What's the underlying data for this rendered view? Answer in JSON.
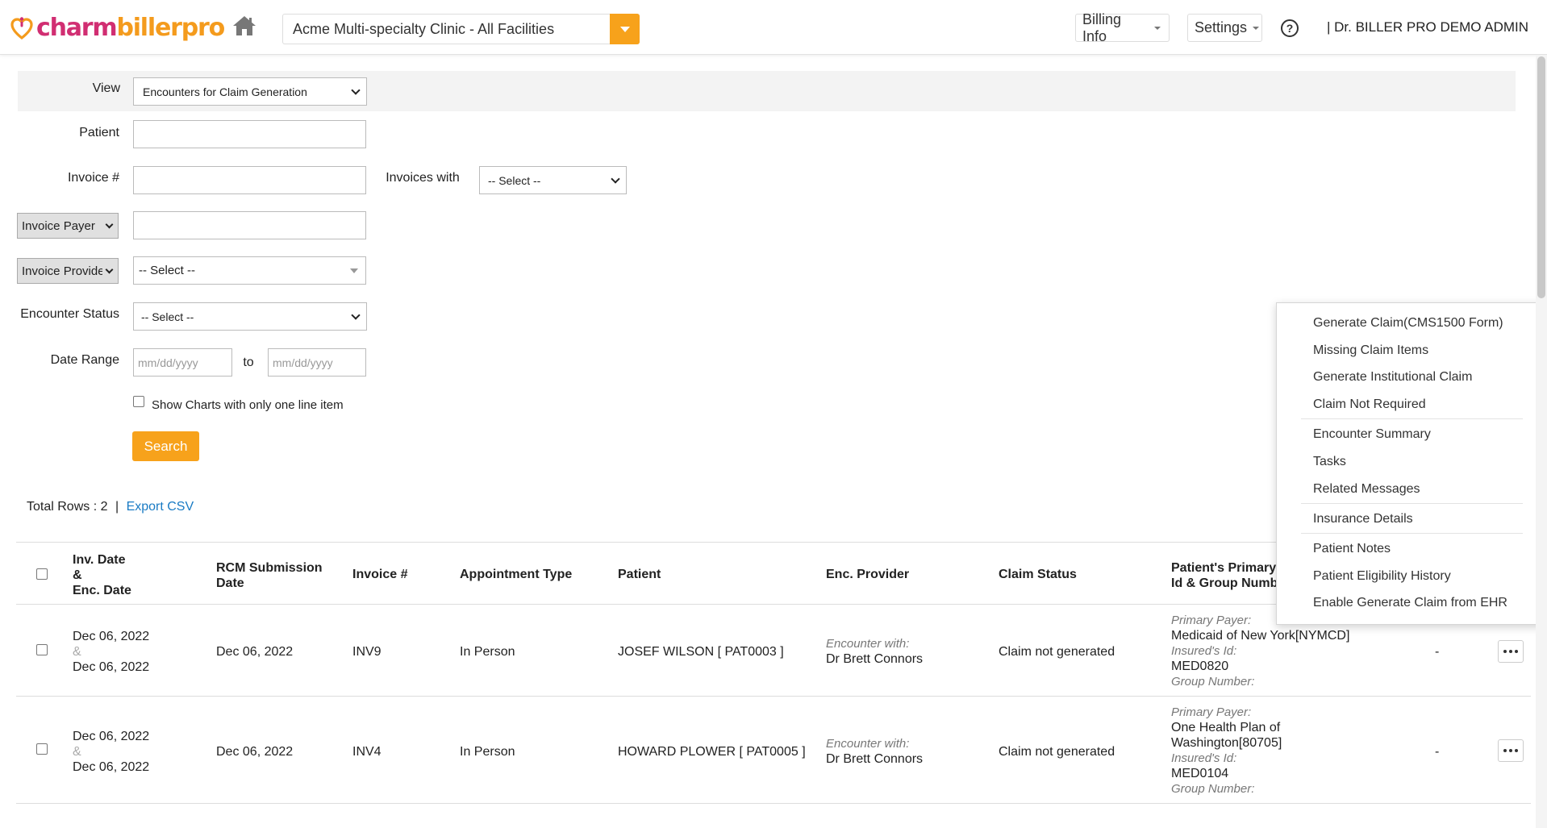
{
  "header": {
    "logo_charm": "charm",
    "logo_biller": "billerpro",
    "facility": "Acme Multi-specialty Clinic - All Facilities",
    "billing_info": "Billing Info",
    "settings": "Settings",
    "help": "?",
    "user": "|  Dr. BILLER PRO DEMO ADMIN"
  },
  "filters": {
    "view_label": "View",
    "view_value": "Encounters for Claim Generation",
    "patient_label": "Patient",
    "patient_value": "",
    "invoice_label": "Invoice #",
    "invoice_value": "",
    "invoices_with_label": "Invoices with",
    "invoices_with_value": "-- Select --",
    "payer_select": "Invoice Payer",
    "payer_value": "",
    "provider_select": "Invoice Provider",
    "provider_value": "-- Select --",
    "encounter_status_label": "Encounter Status",
    "encounter_status_value": "-- Select --",
    "date_range_label": "Date Range",
    "date_from_placeholder": "mm/dd/yyyy",
    "date_to_label": "to",
    "date_to_placeholder": "mm/dd/yyyy",
    "one_line_item_label": "Show Charts with only one line item",
    "search_button": "Search"
  },
  "summary": {
    "total_rows_label": "Total Rows : ",
    "total_rows": "2",
    "separator": "|",
    "export_csv": "Export CSV"
  },
  "table": {
    "columns": {
      "inv_date": "Inv. Date",
      "amp": "&",
      "enc_date": "Enc. Date",
      "rcm_1": "RCM Submission",
      "rcm_2": "Date",
      "invoice": "Invoice #",
      "appt_type": "Appointment Type",
      "patient": "Patient",
      "enc_provider": "Enc. Provider",
      "claim_status": "Claim Status",
      "primary_1": "Patient's Primary",
      "primary_2": "Id & Group Numb"
    },
    "rows": [
      {
        "inv_date": "Dec 06, 2022",
        "amp": "&",
        "enc_date": "Dec 06, 2022",
        "rcm_date": "Dec 06, 2022",
        "invoice": "INV9",
        "appt_type": "In Person",
        "patient": "JOSEF WILSON [ PAT0003 ]",
        "enc_with_label": "Encounter with:",
        "provider": "Dr Brett Connors",
        "claim_status": "Claim not generated",
        "payer_label": "Primary Payer:",
        "payer_1": "Medicaid of New York[NYMCD]",
        "payer_2": "",
        "insured_label": "Insured's Id:",
        "insured_id": "MED0820",
        "group_label": "Group Number:",
        "extra": "-"
      },
      {
        "inv_date": "Dec 06, 2022",
        "amp": "&",
        "enc_date": "Dec 06, 2022",
        "rcm_date": "Dec 06, 2022",
        "invoice": "INV4",
        "appt_type": "In Person",
        "patient": "HOWARD PLOWER [ PAT0005 ]",
        "enc_with_label": "Encounter with:",
        "provider": "Dr Brett Connors",
        "claim_status": "Claim not generated",
        "payer_label": "Primary Payer:",
        "payer_1": "One Health Plan of",
        "payer_2": "Washington[80705]",
        "insured_label": "Insured's Id:",
        "insured_id": "MED0104",
        "group_label": "Group Number:",
        "extra": "-"
      }
    ]
  },
  "context_menu": {
    "items": [
      "Generate Claim(CMS1500 Form)",
      "Missing Claim Items",
      "Generate Institutional Claim",
      "Claim Not Required",
      "Encounter Summary",
      "Tasks",
      "Related Messages",
      "Insurance Details",
      "Patient Notes",
      "Patient Eligibility History",
      "Enable Generate Claim from EHR"
    ]
  },
  "colors": {
    "brand_pink": "#d12e72",
    "brand_orange": "#f49b1d",
    "accent_button": "#f7a21b",
    "link": "#1a7bc4"
  }
}
